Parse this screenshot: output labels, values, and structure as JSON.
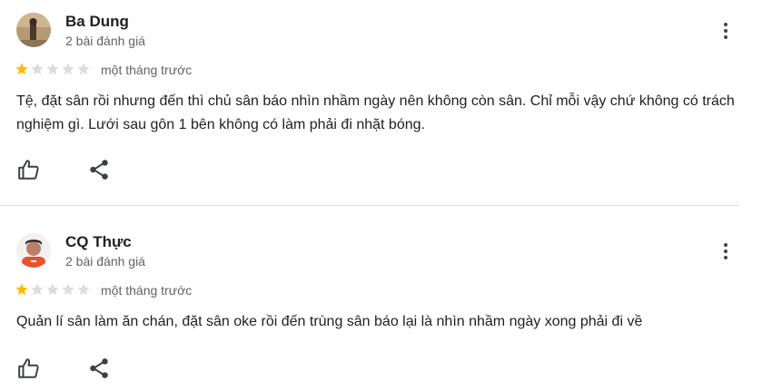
{
  "reviews": [
    {
      "author": "Ba Dung",
      "review_count": "2 bài đánh giá",
      "rating": 1,
      "max_rating": 5,
      "time": "một tháng trước",
      "text": "Tệ, đặt sân rồi nhưng đến thì chủ sân báo nhìn nhầm ngày nên không còn sân. Chỉ mỗi vậy chứ không có trách nghiệm gì. Lưới sau gôn 1 bên không có làm phải đi nhặt bóng."
    },
    {
      "author": "CQ Thực",
      "review_count": "2 bài đánh giá",
      "rating": 1,
      "max_rating": 5,
      "time": "một tháng trước",
      "text": "Quản lí sân làm ăn chán, đặt sân oke rồi đến trùng sân báo lại là nhìn nhầm ngày xong phải đi về"
    }
  ],
  "colors": {
    "star_filled": "#fbbc04",
    "star_empty": "#dadce0",
    "icon": "#3c4043"
  },
  "icons": {
    "like": "thumbs-up-icon",
    "share": "share-icon",
    "more": "more-vert-icon"
  }
}
